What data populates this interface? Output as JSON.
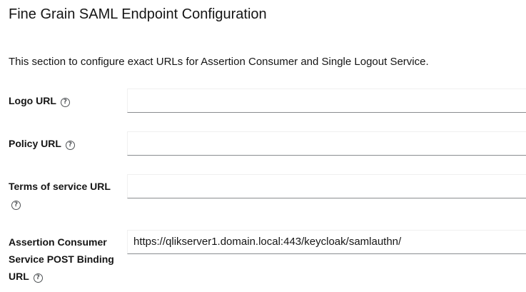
{
  "section": {
    "title": "Fine Grain SAML Endpoint Configuration",
    "description": "This section to configure exact URLs for Assertion Consumer and Single Logout Service."
  },
  "fields": {
    "logo_url": {
      "label": "Logo URL",
      "value": "",
      "help_icon": "question-circle-icon"
    },
    "policy_url": {
      "label": "Policy URL",
      "value": "",
      "help_icon": "question-circle-icon"
    },
    "terms_url": {
      "label": "Terms of service URL",
      "value": "",
      "help_icon": "question-circle-icon"
    },
    "assertion_consumer_post_url": {
      "label": "Assertion Consumer Service POST Binding URL",
      "value": "https://qlikserver1.domain.local:443/keycloak/samlauthn/",
      "help_icon": "question-circle-icon"
    }
  },
  "colors": {
    "text": "#151515",
    "field_border": "#8a8d90",
    "help_icon": "#4f5255"
  }
}
